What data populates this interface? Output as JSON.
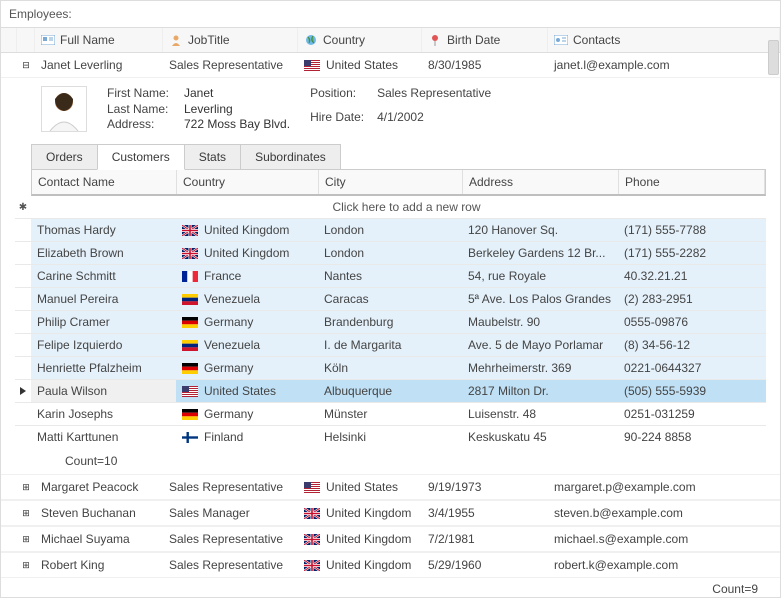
{
  "title": "Employees:",
  "columns": {
    "fullName": "Full Name",
    "jobTitle": "JobTitle",
    "country": "Country",
    "birthDate": "Birth Date",
    "contacts": "Contacts"
  },
  "expanded": {
    "fullName": "Janet Leverling",
    "jobTitle": "Sales Representative",
    "country": "United States",
    "birthDate": "8/30/1985",
    "contacts": "janet.l@example.com",
    "detail": {
      "firstNameLabel": "First Name:",
      "firstName": "Janet",
      "lastNameLabel": "Last Name:",
      "lastName": "Leverling",
      "addressLabel": "Address:",
      "address": "722 Moss Bay Blvd.",
      "positionLabel": "Position:",
      "position": "Sales Representative",
      "hireDateLabel": "Hire Date:",
      "hireDate": "4/1/2002"
    }
  },
  "tabs": {
    "orders": "Orders",
    "customers": "Customers",
    "stats": "Stats",
    "subordinates": "Subordinates"
  },
  "subColumns": {
    "contact": "Contact Name",
    "country": "Country",
    "city": "City",
    "address": "Address",
    "phone": "Phone"
  },
  "addRowText": "Click here to add a new row",
  "customers": [
    {
      "contact": "Thomas Hardy",
      "country": "United Kingdom",
      "flag": "uk",
      "city": "London",
      "address": "120 Hanover Sq.",
      "phone": "(171) 555-7788"
    },
    {
      "contact": "Elizabeth Brown",
      "country": "United Kingdom",
      "flag": "uk",
      "city": "London",
      "address": "Berkeley Gardens 12  Br...",
      "phone": "(171) 555-2282"
    },
    {
      "contact": "Carine Schmitt",
      "country": "France",
      "flag": "fr",
      "city": "Nantes",
      "address": "54, rue Royale",
      "phone": "40.32.21.21"
    },
    {
      "contact": "Manuel Pereira",
      "country": "Venezuela",
      "flag": "ve",
      "city": "Caracas",
      "address": "5ª Ave. Los Palos Grandes",
      "phone": "(2) 283-2951"
    },
    {
      "contact": "Philip Cramer",
      "country": "Germany",
      "flag": "de",
      "city": "Brandenburg",
      "address": "Maubelstr. 90",
      "phone": "0555-09876"
    },
    {
      "contact": "Felipe Izquierdo",
      "country": "Venezuela",
      "flag": "ve",
      "city": "I. de Margarita",
      "address": "Ave. 5 de Mayo Porlamar",
      "phone": "(8) 34-56-12"
    },
    {
      "contact": "Henriette Pfalzheim",
      "country": "Germany",
      "flag": "de",
      "city": "Köln",
      "address": "Mehrheimerstr. 369",
      "phone": "0221-0644327"
    },
    {
      "contact": "Paula Wilson",
      "country": "United States",
      "flag": "us",
      "city": "Albuquerque",
      "address": "2817 Milton Dr.",
      "phone": "(505) 555-5939"
    },
    {
      "contact": "Karin Josephs",
      "country": "Germany",
      "flag": "de",
      "city": "Münster",
      "address": "Luisenstr. 48",
      "phone": "0251-031259"
    },
    {
      "contact": "Matti Karttunen",
      "country": "Finland",
      "flag": "fi",
      "city": "Helsinki",
      "address": "Keskuskatu 45",
      "phone": "90-224 8858"
    }
  ],
  "customerCount": "Count=10",
  "employees": [
    {
      "fullName": "Margaret Peacock",
      "jobTitle": "Sales Representative",
      "flag": "us",
      "country": "United States",
      "birthDate": "9/19/1973",
      "contacts": "margaret.p@example.com"
    },
    {
      "fullName": "Steven Buchanan",
      "jobTitle": "Sales Manager",
      "flag": "uk",
      "country": "United Kingdom",
      "birthDate": "3/4/1955",
      "contacts": "steven.b@example.com"
    },
    {
      "fullName": "Michael Suyama",
      "jobTitle": "Sales Representative",
      "flag": "uk",
      "country": "United Kingdom",
      "birthDate": "7/2/1981",
      "contacts": "michael.s@example.com"
    },
    {
      "fullName": "Robert King",
      "jobTitle": "Sales Representative",
      "flag": "uk",
      "country": "United Kingdom",
      "birthDate": "5/29/1960",
      "contacts": "robert.k@example.com"
    }
  ],
  "footerCount": "Count=9"
}
